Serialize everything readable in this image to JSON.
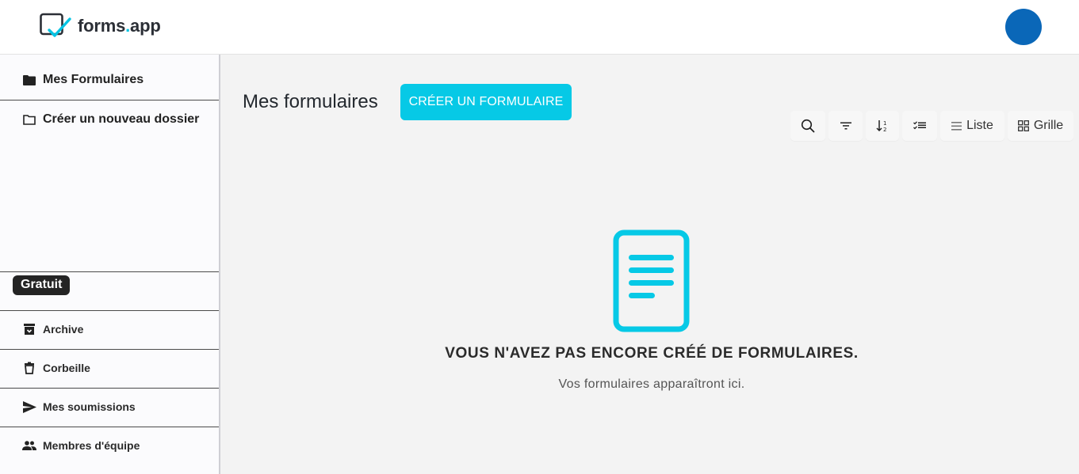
{
  "brand": {
    "name_prefix": "forms",
    "name_dot": ".",
    "name_suffix": "app"
  },
  "header": {
    "avatar_color": "#0a67b8"
  },
  "sidebar": {
    "top_items": [
      {
        "label": "Mes Formulaires",
        "icon": "folder-filled-icon"
      },
      {
        "label": "Créer un nouveau dossier",
        "icon": "folder-outline-icon"
      }
    ],
    "plan_badge": "Gratuit",
    "bottom_items": [
      {
        "label": "Archive",
        "icon": "archive-icon"
      },
      {
        "label": "Corbeille",
        "icon": "trash-icon"
      },
      {
        "label": "Mes soumissions",
        "icon": "send-icon"
      },
      {
        "label": "Membres d'équipe",
        "icon": "people-icon"
      }
    ]
  },
  "main": {
    "title": "Mes formulaires",
    "create_button": "CRÉER UN FORMULAIRE",
    "toolbar": {
      "search_icon": "search-icon",
      "filter_icon": "filter-icon",
      "sort_icon": "sort-icon",
      "select_icon": "checklist-icon",
      "list_label": "Liste",
      "grid_label": "Grille"
    },
    "empty_state": {
      "title": "VOUS N'AVEZ PAS ENCORE CRÉÉ DE FORMULAIRES.",
      "subtitle": "Vos formulaires apparaîtront ici."
    }
  },
  "colors": {
    "accent": "#06c9e6",
    "badge_bg": "#242424"
  }
}
